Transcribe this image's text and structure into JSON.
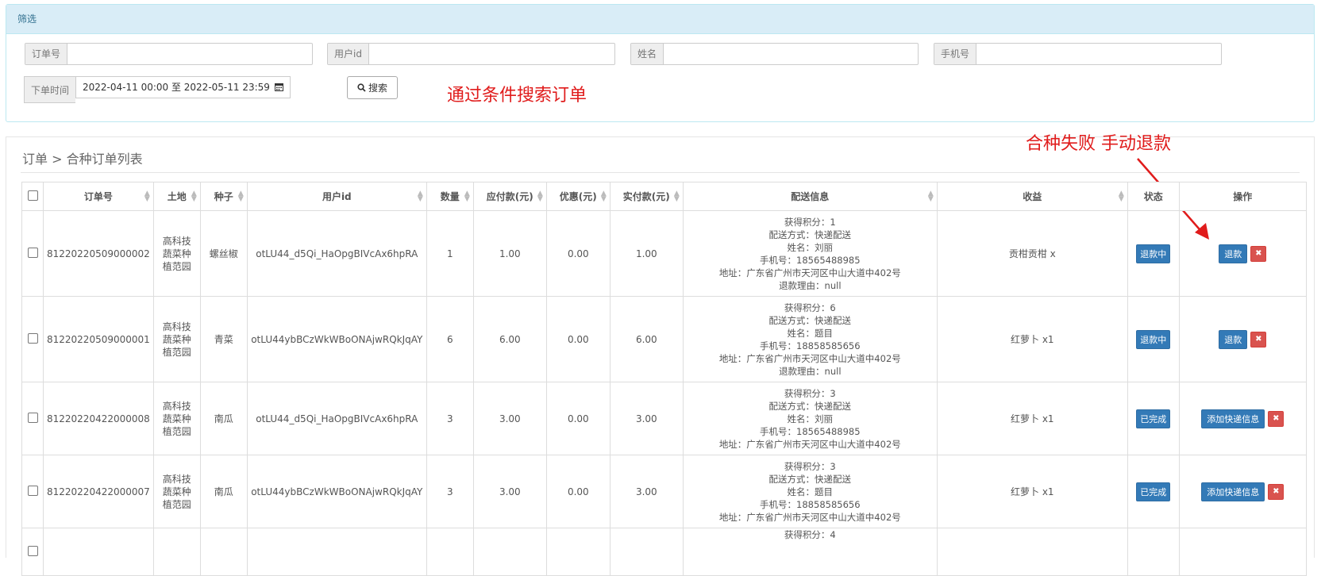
{
  "filter": {
    "heading": "筛选",
    "fields": [
      {
        "label": "订单号",
        "value": "",
        "placeholder": ""
      },
      {
        "label": "用户id",
        "value": "",
        "placeholder": ""
      },
      {
        "label": "姓名",
        "value": "",
        "placeholder": ""
      },
      {
        "label": "手机号",
        "value": "",
        "placeholder": ""
      }
    ],
    "date_label": "下单时间",
    "date_value": "2022-04-11 00:00 至 2022-05-11 23:59",
    "search_label": "搜索"
  },
  "annotations": {
    "search_note": "通过条件搜索订单",
    "refund_note": "合种失败  手动退款"
  },
  "list": {
    "breadcrumb": "订单 > 合种订单列表",
    "columns": [
      "订单号",
      "土地",
      "种子",
      "用户id",
      "数量",
      "应付款(元)",
      "优惠(元)",
      "实付款(元)",
      "配送信息",
      "收益",
      "状态",
      "操作"
    ],
    "rows": [
      {
        "order_no": "81220220509000002",
        "land": [
          "高科技",
          "蔬菜种",
          "植范园"
        ],
        "seed": "螺丝椒",
        "user_id": "otLU44_d5Qi_HaOpgBIVcAx6hpRA",
        "qty": "1",
        "payable": "1.00",
        "discount": "0.00",
        "paid": "1.00",
        "ship": [
          "获得积分：1",
          "配送方式：快递配送",
          "姓名：刘丽",
          "手机号：18565488985",
          "地址：广东省广州市天河区中山大道中402号",
          "退款理由：null"
        ],
        "income": "贡柑贡柑 x",
        "status": "退款中",
        "action": "退款"
      },
      {
        "order_no": "81220220509000001",
        "land": [
          "高科技",
          "蔬菜种",
          "植范园"
        ],
        "seed": "青菜",
        "user_id": "otLU44ybBCzWkWBoONAjwRQkJqAY",
        "qty": "6",
        "payable": "6.00",
        "discount": "0.00",
        "paid": "6.00",
        "ship": [
          "获得积分：6",
          "配送方式：快递配送",
          "姓名：题目",
          "手机号：18858585656",
          "地址：广东省广州市天河区中山大道中402号",
          "退款理由：null"
        ],
        "income": "红萝卜 x1",
        "status": "退款中",
        "action": "退款"
      },
      {
        "order_no": "81220220422000008",
        "land": [
          "高科技",
          "蔬菜种",
          "植范园"
        ],
        "seed": "南瓜",
        "user_id": "otLU44_d5Qi_HaOpgBIVcAx6hpRA",
        "qty": "3",
        "payable": "3.00",
        "discount": "0.00",
        "paid": "3.00",
        "ship": [
          "获得积分：3",
          "配送方式：快递配送",
          "姓名：刘丽",
          "手机号：18565488985",
          "地址：广东省广州市天河区中山大道中402号"
        ],
        "income": "红萝卜 x1",
        "status": "已完成",
        "action": "添加快递信息"
      },
      {
        "order_no": "81220220422000007",
        "land": [
          "高科技",
          "蔬菜种",
          "植范园"
        ],
        "seed": "南瓜",
        "user_id": "otLU44ybBCzWkWBoONAjwRQkJqAY",
        "qty": "3",
        "payable": "3.00",
        "discount": "0.00",
        "paid": "3.00",
        "ship": [
          "获得积分：3",
          "配送方式：快递配送",
          "姓名：题目",
          "手机号：18858585656",
          "地址：广东省广州市天河区中山大道中402号"
        ],
        "income": "红萝卜 x1",
        "status": "已完成",
        "action": "添加快递信息"
      },
      {
        "ship": [
          "获得积分：4"
        ]
      }
    ]
  },
  "icons": {
    "search": "search-icon",
    "calendar": "calendar-icon",
    "delete": "close-icon",
    "sort": "sort-icon"
  },
  "colors": {
    "primary": "#337ab7",
    "danger": "#d9534f",
    "heading_bg": "#d9edf7",
    "annotation": "#e01b1b"
  }
}
